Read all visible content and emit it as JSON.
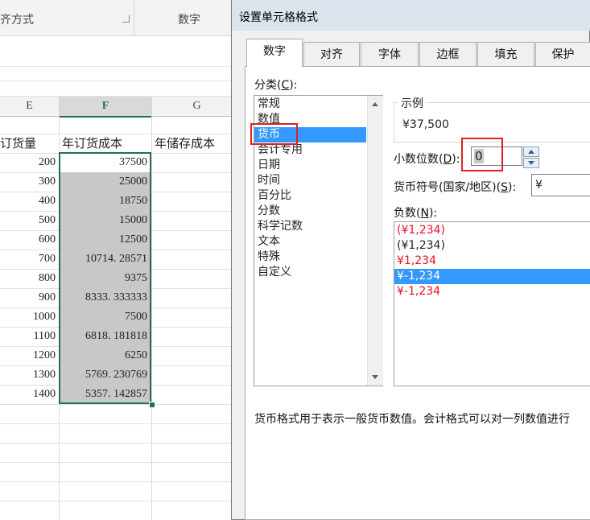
{
  "ribbon": {
    "alignment_group": "齐方式",
    "number_group": "数字",
    "launcher_icon": "dialog-launcher-icon"
  },
  "sheet": {
    "columns": [
      "E",
      "F",
      "G"
    ],
    "selected_column": "F",
    "header_row": [
      "订货量",
      "年订货成本",
      "年储存成本"
    ],
    "rows": [
      {
        "e": "200",
        "f": "37500"
      },
      {
        "e": "300",
        "f": "25000"
      },
      {
        "e": "400",
        "f": "18750"
      },
      {
        "e": "500",
        "f": "15000"
      },
      {
        "e": "600",
        "f": "12500"
      },
      {
        "e": "700",
        "f": "10714. 28571"
      },
      {
        "e": "800",
        "f": "9375"
      },
      {
        "e": "900",
        "f": "8333. 333333"
      },
      {
        "e": "1000",
        "f": "7500"
      },
      {
        "e": "1100",
        "f": "6818. 181818"
      },
      {
        "e": "1200",
        "f": "6250"
      },
      {
        "e": "1300",
        "f": "5769. 230769"
      },
      {
        "e": "1400",
        "f": "5357. 142857"
      }
    ],
    "selection_color": "#217346"
  },
  "dialog": {
    "title": "设置单元格格式",
    "tabs": [
      {
        "label": "数字",
        "active": true
      },
      {
        "label": "对齐",
        "active": false
      },
      {
        "label": "字体",
        "active": false
      },
      {
        "label": "边框",
        "active": false
      },
      {
        "label": "填充",
        "active": false
      },
      {
        "label": "保护",
        "active": false
      }
    ],
    "category_label": "分类(",
    "category_key": "C",
    "category_label_end": "):",
    "categories": [
      "常规",
      "数值",
      "货币",
      "会计专用",
      "日期",
      "时间",
      "百分比",
      "分数",
      "科学记数",
      "文本",
      "特殊",
      "自定义"
    ],
    "selected_category": "货币",
    "sample_title": "示例",
    "sample_value": "¥37,500",
    "decimal_label": "小数位数(",
    "decimal_key": "D",
    "decimal_label_end": "):",
    "decimal_value": "0",
    "currency_label": "货币符号(国家/地区)(",
    "currency_key": "S",
    "currency_label_end": "):",
    "currency_value": "¥",
    "negative_label": "负数(",
    "negative_key": "N",
    "negative_label_end": "):",
    "negatives": [
      {
        "text": "(¥1,234)",
        "red": true
      },
      {
        "text": "(¥1,234)",
        "red": false
      },
      {
        "text": "¥1,234",
        "red": true
      },
      {
        "text": "¥-1,234",
        "red": false
      },
      {
        "text": "¥-1,234",
        "red": true
      }
    ],
    "selected_negative": 3,
    "description": "货币格式用于表示一般货币数值。会计格式可以对一列数值进行",
    "highlight_color": "#3399ff",
    "negative_red": "#e81123",
    "annotation_color": "#e02020"
  }
}
